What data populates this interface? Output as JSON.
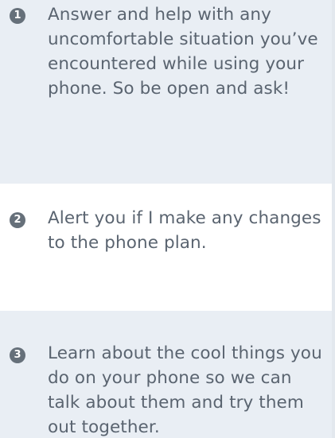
{
  "items": [
    {
      "number": "1",
      "text": "Answer and help with any uncomfortable situation you’ve encountered while using your phone. So be open and ask!"
    },
    {
      "number": "2",
      "text": "Alert you if I make any changes to the phone plan."
    },
    {
      "number": "3",
      "text": "Learn about the cool things you do on your phone so we can talk about them and try them out together."
    }
  ],
  "colors": {
    "alt_row_background": "#e9eef4",
    "text": "#5a6470",
    "number_badge": "#66707a"
  }
}
